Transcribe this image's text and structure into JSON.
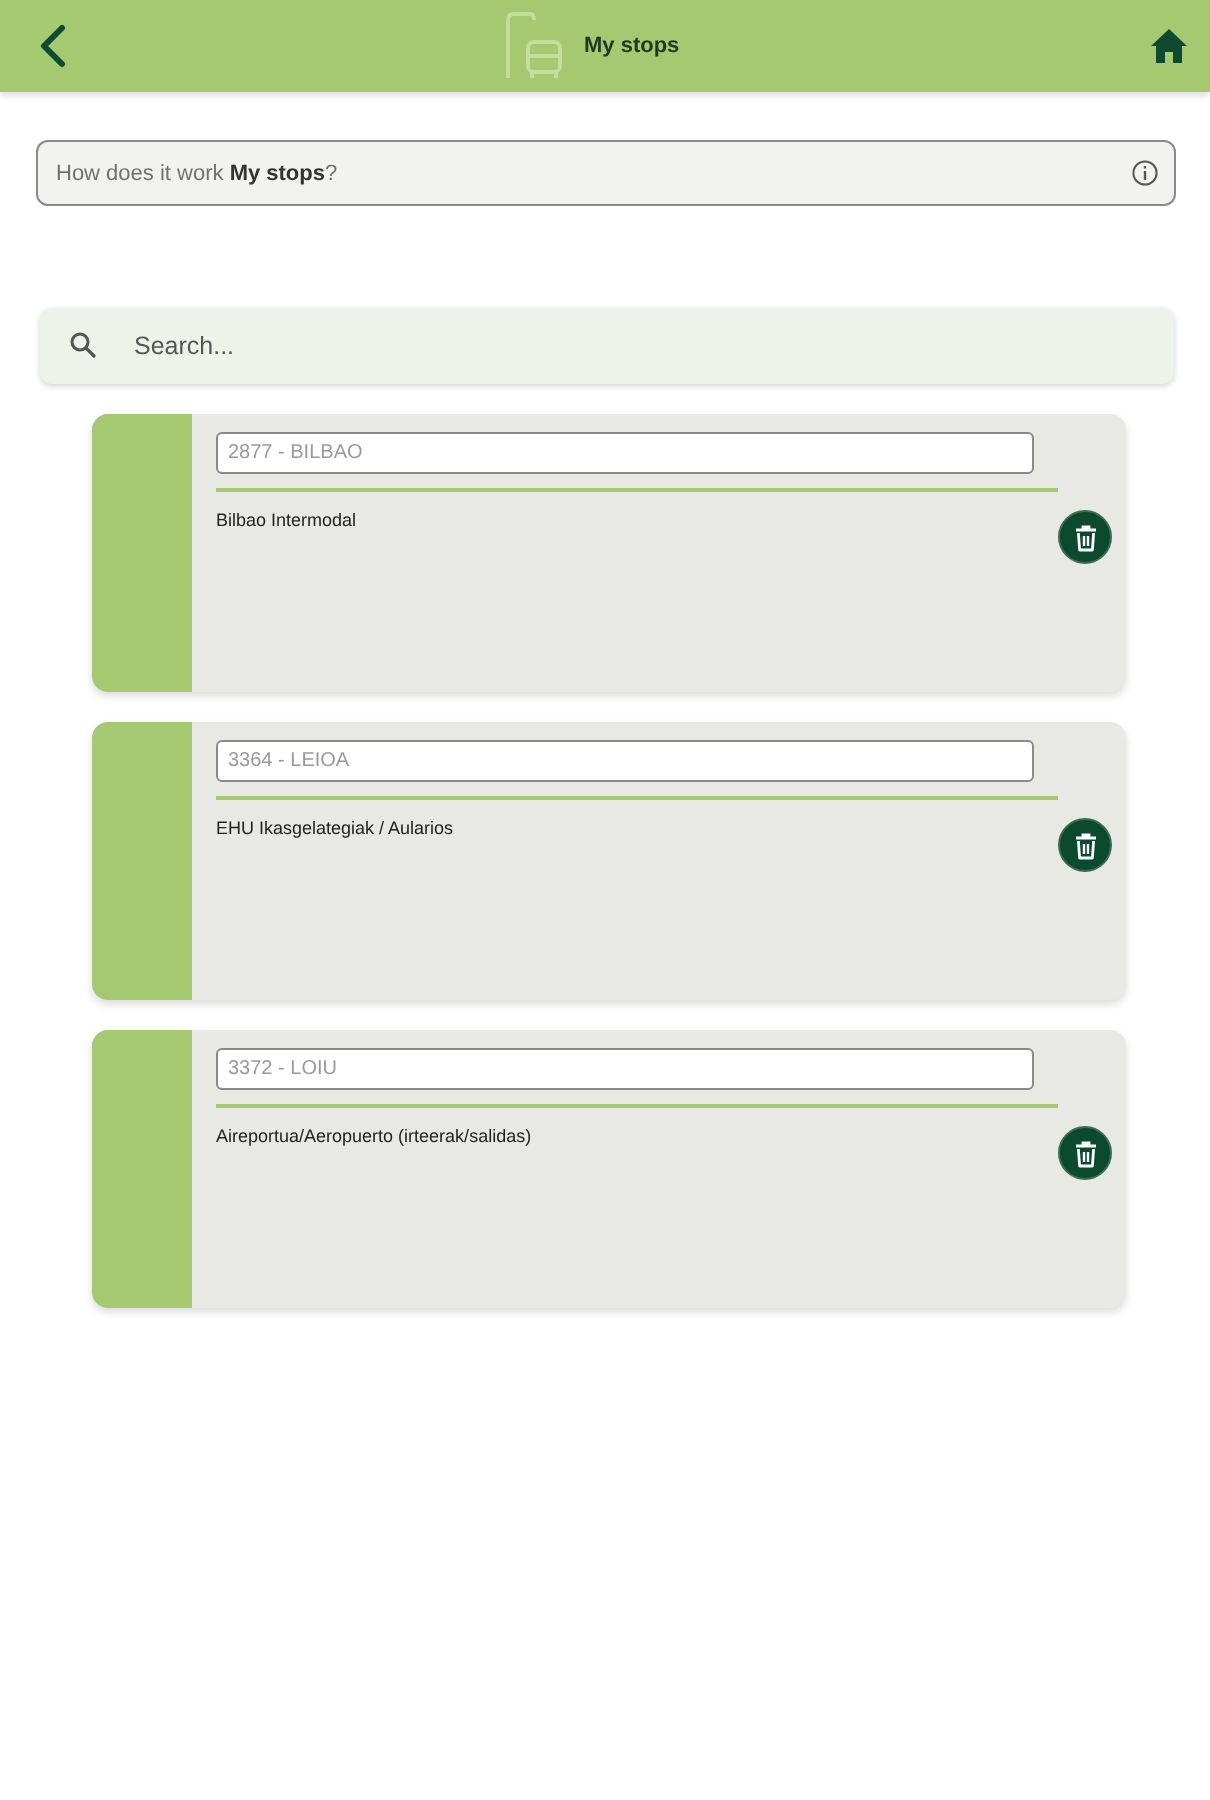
{
  "header": {
    "title": "My stops"
  },
  "help_bar": {
    "text": "How does it work **My stops**?"
  },
  "search": {
    "placeholder": "Search..."
  },
  "stops": [
    {
      "code": "2877 - BILBAO",
      "name": "Bilbao Intermodal"
    },
    {
      "code": "3364 - LEIOA",
      "name": "EHU Ikasgelategiak / Aularios"
    },
    {
      "code": "3372 - LOIU",
      "name": "Aireportua/Aeropuerto (irteerak/salidas)"
    }
  ]
}
